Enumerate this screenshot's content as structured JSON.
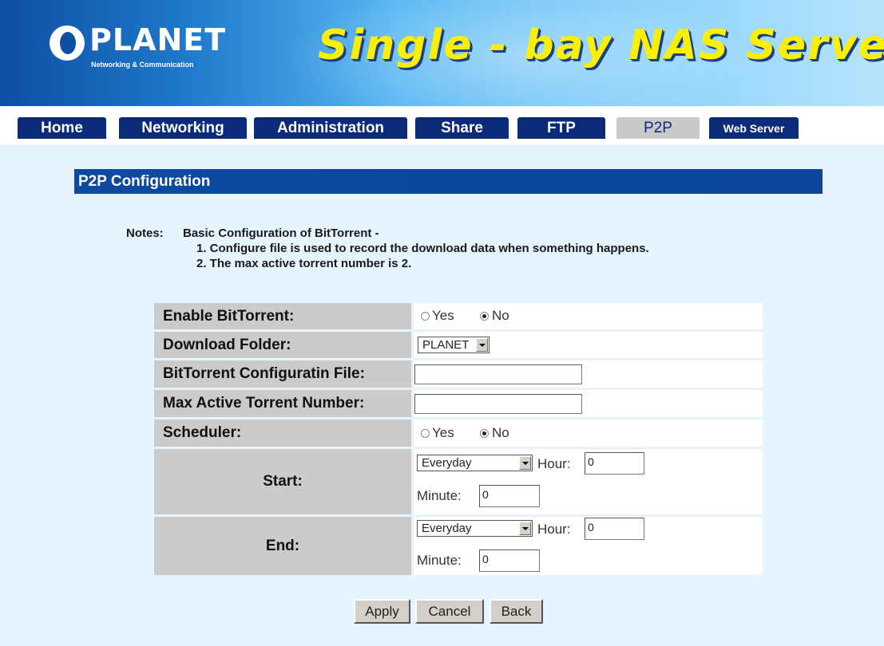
{
  "header": {
    "logo_name": "PLANET",
    "logo_tagline": "Networking & Communication",
    "title": "Single - bay NAS Server"
  },
  "tabs": [
    {
      "label": "Home",
      "active": false
    },
    {
      "label": "Networking",
      "active": false
    },
    {
      "label": "Administration",
      "active": false
    },
    {
      "label": "Share",
      "active": false
    },
    {
      "label": "FTP",
      "active": false
    },
    {
      "label": "P2P",
      "active": true
    },
    {
      "label": "Web Server",
      "active": false
    }
  ],
  "section": {
    "title": "P2P Configuration"
  },
  "notes": {
    "label": "Notes:",
    "lines": [
      "Basic Configuration of BitTorrent -",
      "1. Configure file is used to record the download data when something happens.",
      "2. The max active torrent number is 2."
    ]
  },
  "form": {
    "enable": {
      "label": "Enable BitTorrent:",
      "yes": "Yes",
      "no": "No",
      "selected": "No"
    },
    "download_folder": {
      "label": "Download Folder:",
      "value": "PLANET"
    },
    "config_file": {
      "label": "BitTorrent Configuratin File:",
      "value": ""
    },
    "max_active": {
      "label": "Max Active Torrent Number:",
      "value": ""
    },
    "scheduler": {
      "label": "Scheduler:",
      "yes": "Yes",
      "no": "No",
      "selected": "No"
    },
    "start": {
      "label": "Start:",
      "day": "Everyday",
      "hour_label": "Hour:",
      "hour": "0",
      "minute_label": "Minute:",
      "minute": "0"
    },
    "end": {
      "label": "End:",
      "day": "Everyday",
      "hour_label": "Hour:",
      "hour": "0",
      "minute_label": "Minute:",
      "minute": "0"
    }
  },
  "buttons": {
    "apply": "Apply",
    "cancel": "Cancel",
    "back": "Back"
  },
  "colors": {
    "tab_bg": "#0B2A78",
    "tab_active_bg": "#C9C9C9",
    "section_bar": "#0B4AA0",
    "page_bg": "#E6F4FF",
    "title_yellow": "#FAF000"
  }
}
